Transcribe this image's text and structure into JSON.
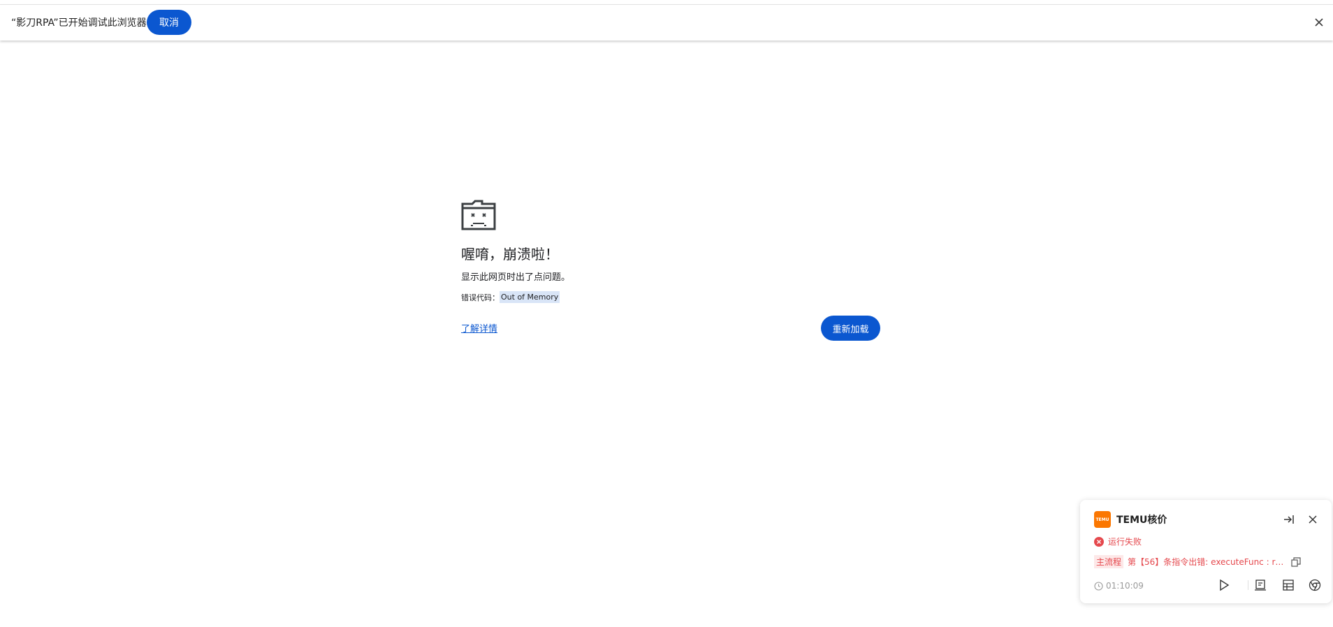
{
  "infobar": {
    "message": "“影刀RPA”已开始调试此浏览器",
    "cancel_label": "取消"
  },
  "crash": {
    "title": "喔唷，崩溃啦！",
    "description": "显示此网页时出了点问题。",
    "error_label": "错误代码：",
    "error_code": "Out of Memory",
    "learn_more": "了解详情",
    "reload_label": "重新加载"
  },
  "rpa": {
    "logo_text": "TEMU",
    "title": "TEMU核价",
    "status": "运行失败",
    "flow_tag": "主流程",
    "error_message": "第【56】条指令出错: executeFunc : run...",
    "elapsed": "01:10:09",
    "colors": {
      "brand": "#fb7701",
      "error": "#e5484d",
      "primary": "#0b57d0"
    }
  }
}
